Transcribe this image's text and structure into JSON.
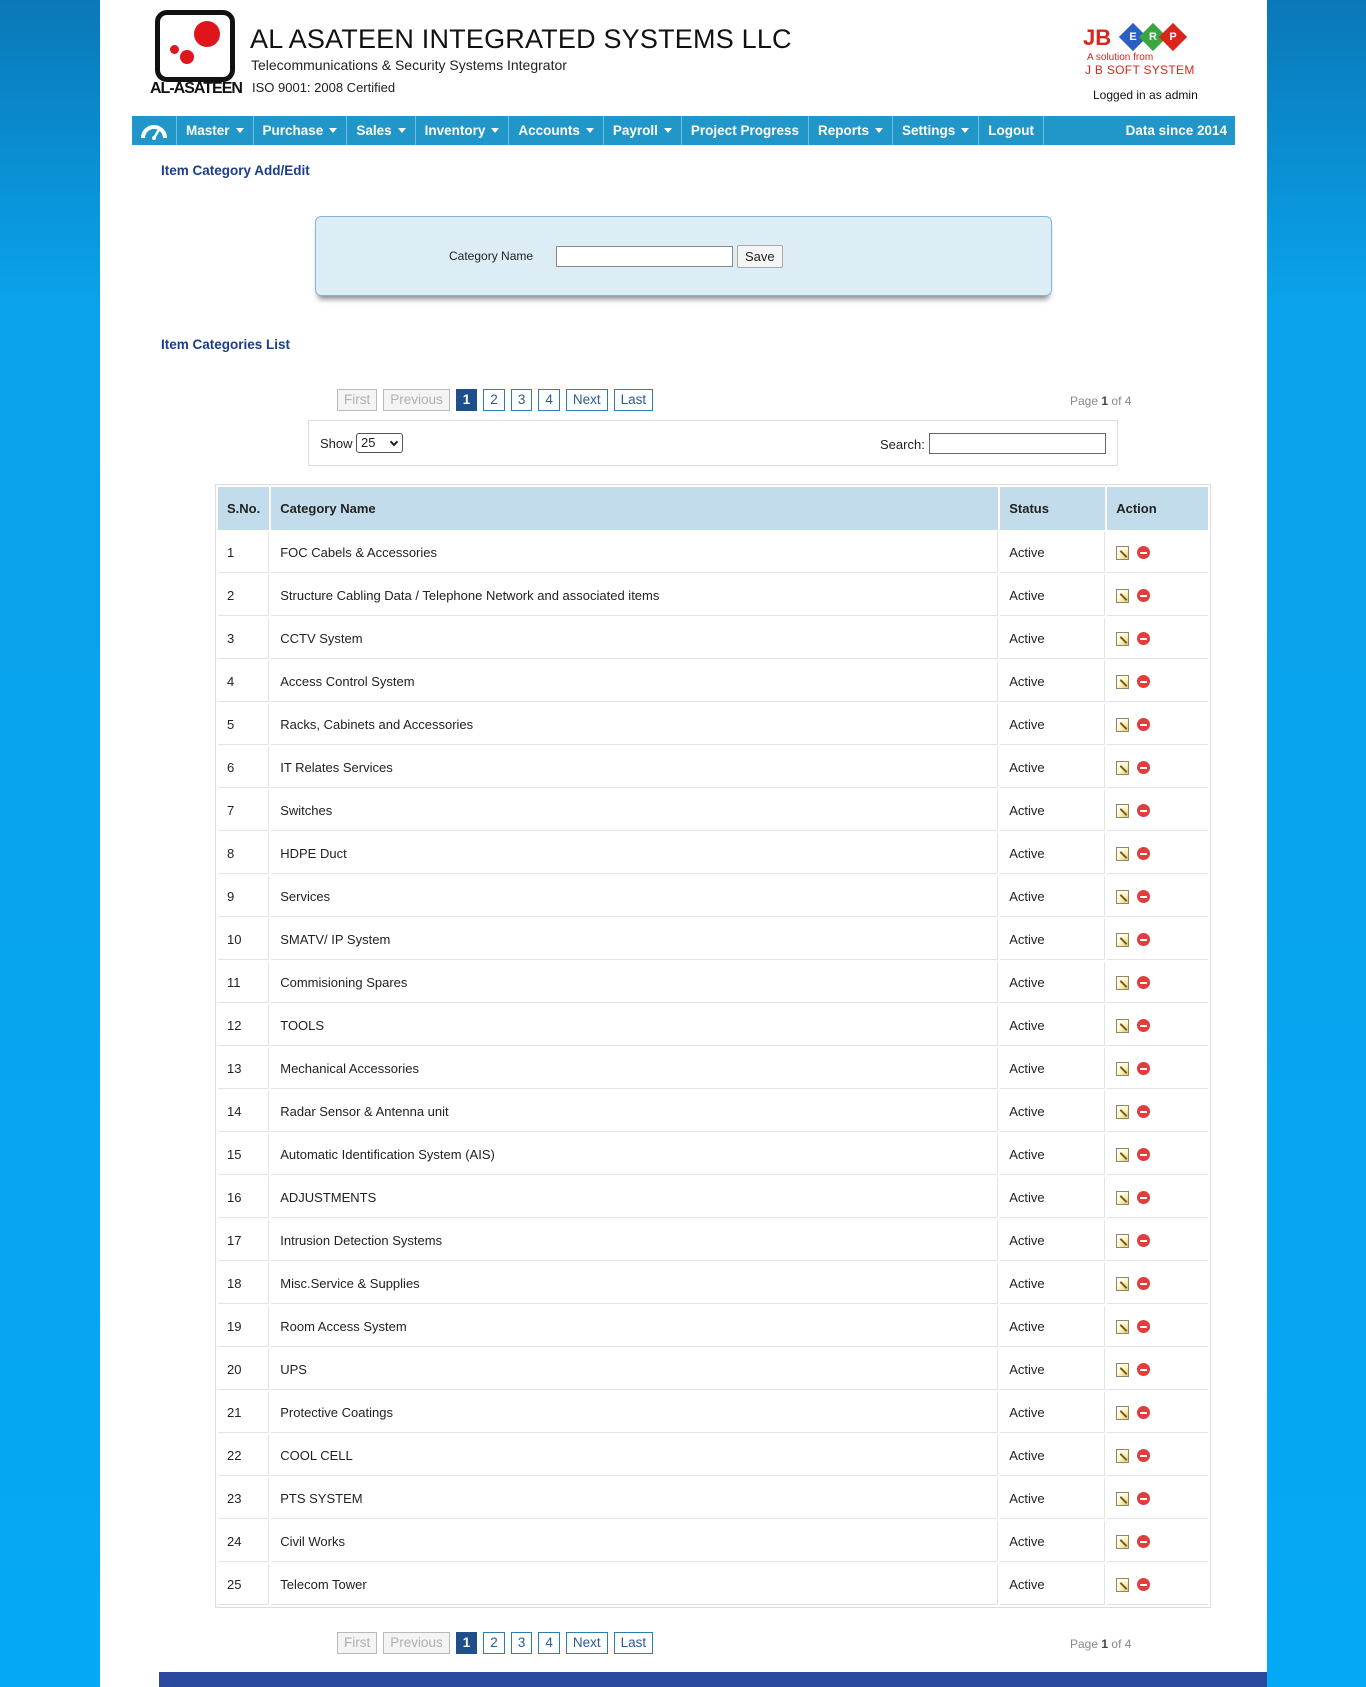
{
  "header": {
    "logo_word": "AL-ASATEEN",
    "company_name": "AL ASATEEN INTEGRATED SYSTEMS LLC",
    "tagline": "Telecommunications & Security Systems Integrator",
    "iso": "ISO 9001: 2008 Certified",
    "erp_brand": {
      "jb": "JB",
      "letters": [
        "E",
        "R",
        "P"
      ],
      "line1": "A solution from",
      "line2": "J B SOFT SYSTEM"
    },
    "logged_in": "Logged in as admin"
  },
  "nav": {
    "items": [
      {
        "label": "Master",
        "dropdown": true
      },
      {
        "label": "Purchase",
        "dropdown": true
      },
      {
        "label": "Sales",
        "dropdown": true
      },
      {
        "label": "Inventory",
        "dropdown": true
      },
      {
        "label": "Accounts",
        "dropdown": true
      },
      {
        "label": "Payroll",
        "dropdown": true
      },
      {
        "label": "Project Progress",
        "dropdown": false
      },
      {
        "label": "Reports",
        "dropdown": true
      },
      {
        "label": "Settings",
        "dropdown": true
      },
      {
        "label": "Logout",
        "dropdown": false
      }
    ],
    "data_since": "Data since 2014"
  },
  "form": {
    "title": "Item Category Add/Edit",
    "label": "Category Name",
    "value": "",
    "save_label": "Save"
  },
  "list": {
    "title": "Item Categories List",
    "pager": {
      "first": "First",
      "previous": "Previous",
      "pages": [
        "1",
        "2",
        "3",
        "4"
      ],
      "next": "Next",
      "last": "Last",
      "page_word": "Page",
      "current": "1",
      "of_word": "of",
      "total": "4"
    },
    "show_label": "Show",
    "show_value": "25",
    "search_label": "Search:",
    "search_value": "",
    "columns": [
      "S.No.",
      "Category Name",
      "Status",
      "Action"
    ],
    "rows": [
      {
        "sno": "1",
        "name": "FOC Cabels & Accessories",
        "status": "Active"
      },
      {
        "sno": "2",
        "name": "Structure Cabling Data / Telephone Network and associated items",
        "status": "Active"
      },
      {
        "sno": "3",
        "name": "CCTV System",
        "status": "Active"
      },
      {
        "sno": "4",
        "name": "Access Control System",
        "status": "Active"
      },
      {
        "sno": "5",
        "name": "Racks, Cabinets and Accessories",
        "status": "Active"
      },
      {
        "sno": "6",
        "name": "IT Relates Services",
        "status": "Active"
      },
      {
        "sno": "7",
        "name": "Switches",
        "status": "Active"
      },
      {
        "sno": "8",
        "name": "HDPE Duct",
        "status": "Active"
      },
      {
        "sno": "9",
        "name": "Services",
        "status": "Active"
      },
      {
        "sno": "10",
        "name": "SMATV/ IP System",
        "status": "Active"
      },
      {
        "sno": "11",
        "name": "Commisioning Spares",
        "status": "Active"
      },
      {
        "sno": "12",
        "name": "TOOLS",
        "status": "Active"
      },
      {
        "sno": "13",
        "name": "Mechanical Accessories",
        "status": "Active"
      },
      {
        "sno": "14",
        "name": "Radar Sensor & Antenna unit",
        "status": "Active"
      },
      {
        "sno": "15",
        "name": "Automatic Identification System (AIS)",
        "status": "Active"
      },
      {
        "sno": "16",
        "name": "ADJUSTMENTS",
        "status": "Active"
      },
      {
        "sno": "17",
        "name": "Intrusion Detection Systems",
        "status": "Active"
      },
      {
        "sno": "18",
        "name": "Misc.Service & Supplies",
        "status": "Active"
      },
      {
        "sno": "19",
        "name": "Room Access System",
        "status": "Active"
      },
      {
        "sno": "20",
        "name": "UPS",
        "status": "Active"
      },
      {
        "sno": "21",
        "name": "Protective Coatings",
        "status": "Active"
      },
      {
        "sno": "22",
        "name": "COOL CELL",
        "status": "Active"
      },
      {
        "sno": "23",
        "name": "PTS SYSTEM",
        "status": "Active"
      },
      {
        "sno": "24",
        "name": "Civil Works",
        "status": "Active"
      },
      {
        "sno": "25",
        "name": "Telecom Tower",
        "status": "Active"
      }
    ]
  },
  "colors": {
    "nav_bg": "#2196c9",
    "title_blue": "#1a3e8a",
    "header_cell": "#c3dcec",
    "brand_red": "#d9251c",
    "erp_e": "#2b5fc2",
    "erp_r": "#3aa640",
    "erp_p": "#d9251c"
  },
  "icons": {
    "home": "dashboard-gauge-icon",
    "edit": "edit-pencil-icon",
    "delete": "delete-minus-icon"
  }
}
